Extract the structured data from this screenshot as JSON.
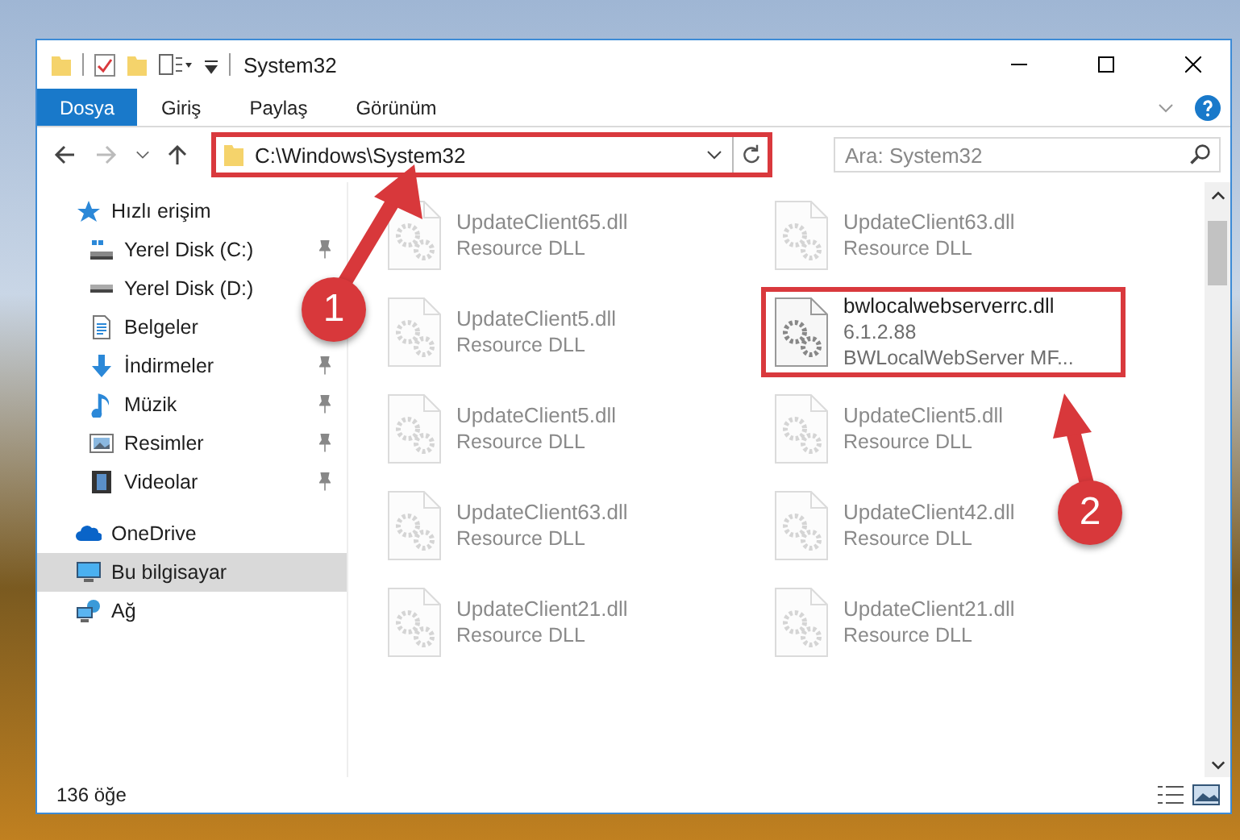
{
  "window": {
    "title": "System32"
  },
  "ribbon_tabs": [
    {
      "label": "Dosya",
      "kind": "menu"
    },
    {
      "label": "Giriş",
      "kind": "tab"
    },
    {
      "label": "Paylaş",
      "kind": "tab"
    },
    {
      "label": "Görünüm",
      "kind": "tab"
    }
  ],
  "address": {
    "path": "C:\\Windows\\System32",
    "highlighted": true,
    "callout": "1"
  },
  "search": {
    "placeholder": "Ara: System32"
  },
  "sidebar": {
    "items": [
      {
        "label": "Hızlı erişim",
        "selected": false,
        "children": [
          {
            "label": "Yerel Disk (C:)",
            "pinned": true,
            "selected": false
          },
          {
            "label": "Yerel Disk (D:)",
            "pinned": false,
            "selected": false
          },
          {
            "label": "Belgeler",
            "pinned": false,
            "selected": false
          },
          {
            "label": "İndirmeler",
            "pinned": true,
            "selected": false
          },
          {
            "label": "Müzik",
            "pinned": true,
            "selected": false
          },
          {
            "label": "Resimler",
            "pinned": true,
            "selected": false
          },
          {
            "label": "Videolar",
            "pinned": true,
            "selected": false
          }
        ]
      },
      {
        "label": "OneDrive",
        "selected": false
      },
      {
        "label": "Bu bilgisayar",
        "selected": true
      },
      {
        "label": "Ağ",
        "selected": false
      }
    ]
  },
  "files": [
    {
      "lines": [
        "UpdateClient65.dll",
        "Resource DLL"
      ],
      "blurred": true,
      "highlighted": false
    },
    {
      "lines": [
        "UpdateClient63.dll",
        "Resource DLL"
      ],
      "blurred": true,
      "highlighted": false
    },
    {
      "lines": [
        "UpdateClient5.dll",
        "Resource DLL"
      ],
      "blurred": true,
      "highlighted": false
    },
    {
      "lines": [
        "bwlocalwebserverrc.dll",
        "6.1.2.88",
        "BWLocalWebServer MF..."
      ],
      "blurred": false,
      "highlighted": true,
      "callout": "2"
    },
    {
      "lines": [
        "UpdateClient5.dll",
        "Resource DLL"
      ],
      "blurred": true,
      "highlighted": false
    },
    {
      "lines": [
        "UpdateClient5.dll",
        "Resource DLL"
      ],
      "blurred": true,
      "highlighted": false
    },
    {
      "lines": [
        "UpdateClient63.dll",
        "Resource DLL"
      ],
      "blurred": true,
      "highlighted": false
    },
    {
      "lines": [
        "UpdateClient42.dll",
        "Resource DLL"
      ],
      "blurred": true,
      "highlighted": false
    },
    {
      "lines": [
        "UpdateClient21.dll",
        "Resource DLL"
      ],
      "blurred": true,
      "highlighted": false
    },
    {
      "lines": [
        "UpdateClient21.dll",
        "Resource DLL"
      ],
      "blurred": true,
      "highlighted": false
    }
  ],
  "status_bar": {
    "count": "136 öğe"
  }
}
